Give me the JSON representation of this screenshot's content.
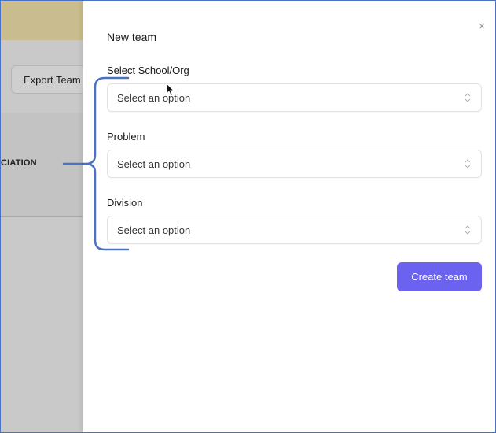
{
  "background": {
    "export_label": "Export Team",
    "association_text": "CIATION"
  },
  "modal": {
    "title": "New team",
    "close_icon": "×",
    "fields": [
      {
        "label": "Select School/Org",
        "placeholder": "Select an option"
      },
      {
        "label": "Problem",
        "placeholder": "Select an option"
      },
      {
        "label": "Division",
        "placeholder": "Select an option"
      }
    ],
    "submit_label": "Create team"
  },
  "colors": {
    "primary_button": "#6b63f0",
    "annotation_bracket": "#4a72c4",
    "topbar": "#c9bc8e"
  },
  "icons": {
    "select_arrows": "chevron-up-down-icon",
    "cursor": "mouse-pointer-icon"
  }
}
